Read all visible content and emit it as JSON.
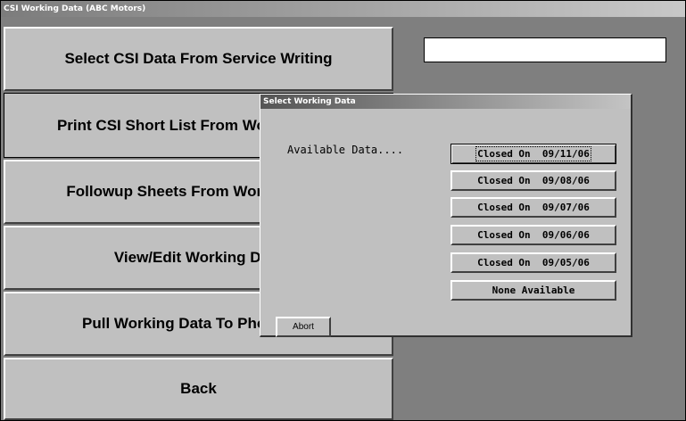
{
  "window": {
    "title": "CSI Working Data    (ABC Motors)"
  },
  "menu": {
    "items": [
      {
        "label": "Select CSI Data From Service Writing"
      },
      {
        "label": "Print CSI Short List From Working Data"
      },
      {
        "label": "Followup Sheets From Working Data"
      },
      {
        "label": "View/Edit Working Data"
      },
      {
        "label": "Pull Working Data To Phone List"
      },
      {
        "label": "Back"
      }
    ]
  },
  "dialog": {
    "title": "Select Working Data",
    "available_label": "Available Data....",
    "options": [
      {
        "label": "Closed On  09/11/06"
      },
      {
        "label": "Closed On  09/08/06"
      },
      {
        "label": "Closed On  09/07/06"
      },
      {
        "label": "Closed On  09/06/06"
      },
      {
        "label": "Closed On  09/05/06"
      },
      {
        "label": "None Available"
      }
    ],
    "abort_label": "Abort"
  },
  "status_box": {
    "value": ""
  }
}
